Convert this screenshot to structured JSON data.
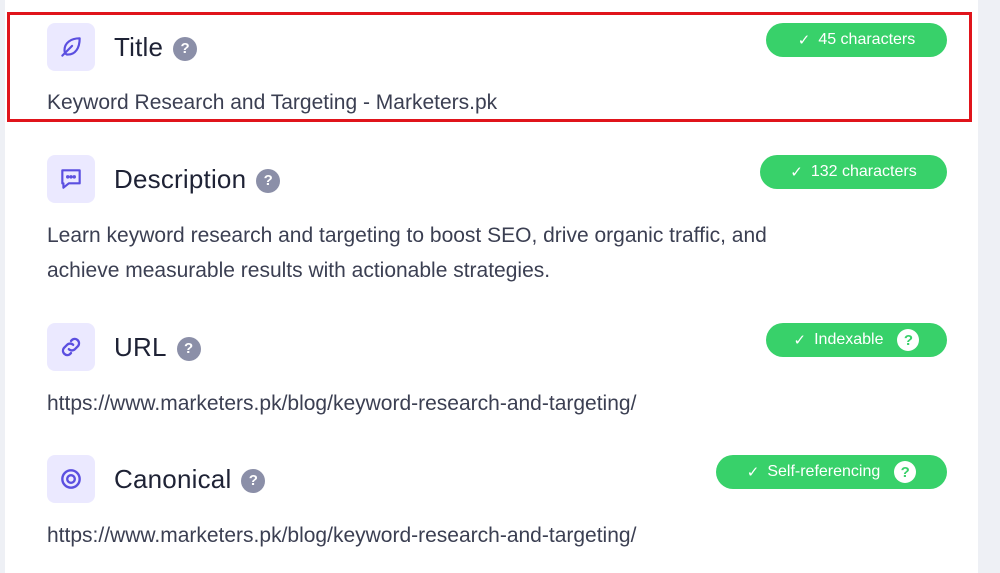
{
  "title_section": {
    "label": "Title",
    "badge": "45 characters",
    "value": "Keyword Research and Targeting - Marketers.pk"
  },
  "description_section": {
    "label": "Description",
    "badge": "132 characters",
    "value_line1": "Learn keyword research and targeting to boost SEO, drive organic traffic, and",
    "value_line2": "achieve measurable results with actionable strategies."
  },
  "url_section": {
    "label": "URL",
    "badge": "Indexable",
    "value": "https://www.marketers.pk/blog/keyword-research-and-targeting/"
  },
  "canonical_section": {
    "label": "Canonical",
    "badge": "Self-referencing",
    "value": "https://www.marketers.pk/blog/keyword-research-and-targeting/"
  },
  "icons": {
    "title": "leaf-icon",
    "description": "message-icon",
    "url": "link-icon",
    "canonical": "target-icon",
    "help": "question-icon",
    "check": "check-icon"
  },
  "colors": {
    "accent": "#5b4fe0",
    "icon_bg": "#ebe9ff",
    "badge_green": "#38d16a",
    "highlight_red": "#e0141b"
  }
}
